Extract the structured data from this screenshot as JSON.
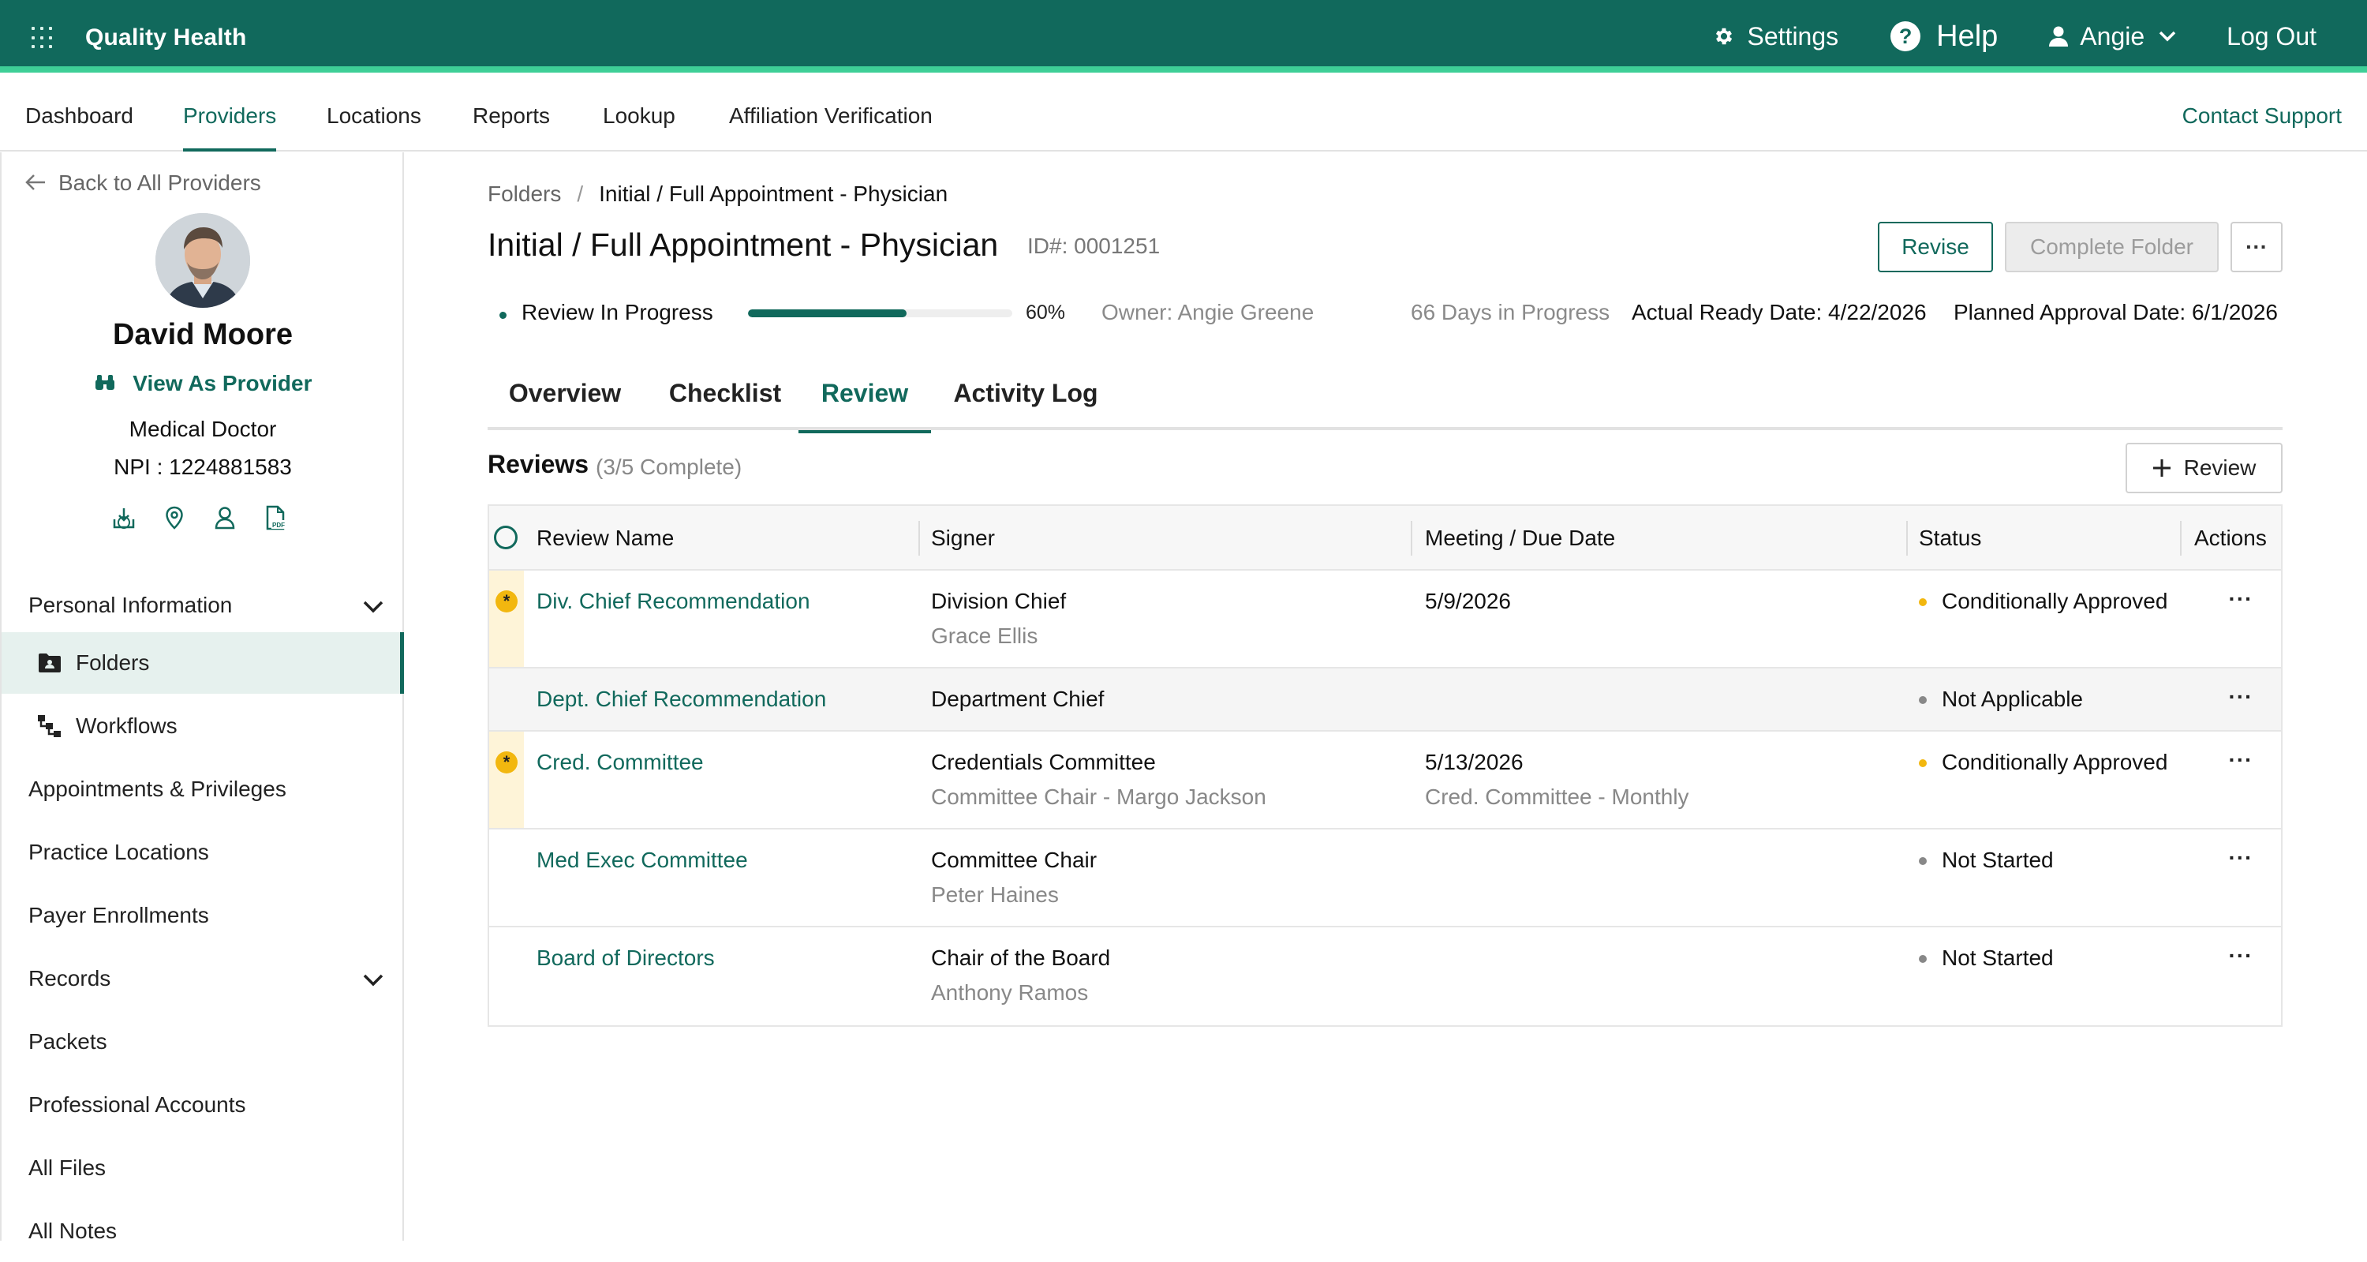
{
  "app": {
    "brand": "Quality Health",
    "settings_label": "Settings",
    "help_label": "Help",
    "help_icon_text": "?",
    "user_label": "Angie",
    "logout_label": "Log Out"
  },
  "nav": {
    "tabs": [
      "Dashboard",
      "Providers",
      "Locations",
      "Reports",
      "Lookup",
      "Affiliation Verification"
    ],
    "active_tab": "Providers",
    "contact_label": "Contact Support"
  },
  "sidebar": {
    "back_label": "Back to All Providers",
    "provider_name": "David Moore",
    "view_as_label": "View As Provider",
    "title": "Medical Doctor",
    "npi": "NPI : 1224881583",
    "quick_icons": [
      "download-icon",
      "location-pin-icon",
      "person-icon",
      "pdf-icon"
    ],
    "menu": [
      {
        "label": "Personal Information",
        "expandable": true
      },
      {
        "label": "Folders",
        "icon": "folder-icon",
        "active": true
      },
      {
        "label": "Workflows",
        "icon": "workflow-icon"
      },
      {
        "label": "Appointments & Privileges"
      },
      {
        "label": "Practice Locations"
      },
      {
        "label": "Payer Enrollments"
      },
      {
        "label": "Records",
        "expandable": true
      },
      {
        "label": "Packets"
      },
      {
        "label": "Professional Accounts"
      },
      {
        "label": "All Files"
      },
      {
        "label": "All Notes"
      }
    ]
  },
  "breadcrumb": {
    "root": "Folders",
    "separator": "/",
    "current": "Initial / Full Appointment - Physician"
  },
  "folder": {
    "title": "Initial / Full Appointment - Physician",
    "id_label": "ID#: 0001251",
    "revise_label": "Revise",
    "complete_label": "Complete Folder",
    "more_label": "···",
    "status": "Review In Progress",
    "progress": 0.6,
    "progress_label": "60%",
    "owner": "Owner: Angie Greene",
    "days": "66 Days in Progress",
    "actual_ready": "Actual Ready Date: 4/22/2026",
    "planned_approval": "Planned Approval Date: 6/1/2026"
  },
  "tabs": [
    "Overview",
    "Checklist",
    "Review",
    "Activity Log"
  ],
  "active_tab": "Review",
  "reviews": {
    "heading": "Reviews",
    "count": "(3/5 Complete)",
    "add_label": "Review",
    "columns": [
      "Review Name",
      "Signer",
      "Meeting / Due Date",
      "Status",
      "Actions"
    ],
    "rows": [
      {
        "name": "Div. Chief Recommendation",
        "signer": "Division Chief",
        "signer_sub": "Grace Ellis",
        "date": "5/9/2026",
        "date_sub": "",
        "status": "Conditionally Approved",
        "status_color": "#f2b70f",
        "flagged": true
      },
      {
        "name": "Dept. Chief Recommendation",
        "signer": "Department Chief",
        "signer_sub": "",
        "date": "",
        "date_sub": "",
        "status": "Not Applicable",
        "status_color": "#888888",
        "flagged": false
      },
      {
        "name": "Cred. Committee",
        "signer": "Credentials Committee",
        "signer_sub": "Committee Chair - Margo Jackson",
        "date": "5/13/2026",
        "date_sub": "Cred. Committee - Monthly",
        "status": "Conditionally Approved",
        "status_color": "#f2b70f",
        "flagged": true
      },
      {
        "name": "Med Exec Committee",
        "signer": "Committee Chair",
        "signer_sub": "Peter Haines",
        "date": "",
        "date_sub": "",
        "status": "Not Started",
        "status_color": "#888888",
        "flagged": false
      },
      {
        "name": "Board of Directors",
        "signer": "Chair of the Board",
        "signer_sub": "Anthony Ramos",
        "date": "",
        "date_sub": "",
        "status": "Not Started",
        "status_color": "#888888",
        "flagged": false
      }
    ],
    "action_label": "···",
    "flag_text": "*"
  },
  "colors": {
    "brand": "#11695c",
    "accent": "#3ecf97",
    "warning": "#f2b70f"
  }
}
